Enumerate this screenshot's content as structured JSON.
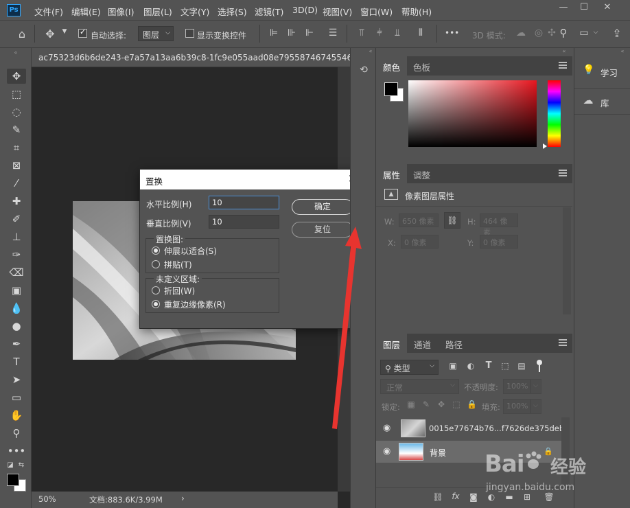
{
  "app": {
    "logo": "Ps"
  },
  "menu": [
    "文件(F)",
    "编辑(E)",
    "图像(I)",
    "图层(L)",
    "文字(Y)",
    "选择(S)",
    "滤镜(T)",
    "3D(D)",
    "视图(V)",
    "窗口(W)",
    "帮助(H)"
  ],
  "window_controls": {
    "minimize": "—",
    "maximize": "☐",
    "close": "✕"
  },
  "options": {
    "auto_select_label": "自动选择:",
    "auto_select_checked": true,
    "auto_select_value": "图层",
    "show_transform_label": "显示变换控件",
    "show_transform_checked": false,
    "mode_3d_label": "3D 模式:",
    "more": "•••"
  },
  "document": {
    "tab_title": "ac75323d6b6de243-e7a57a13aa6b39c8-1fc9e055aad08e79558746745546",
    "zoom": "50%",
    "doc_info": "文档:883.6K/3.99M",
    "status_arrow": "›"
  },
  "dialog": {
    "title": "置换",
    "close": "✕",
    "h_scale_label": "水平比例(H)",
    "h_scale_value": "10",
    "v_scale_label": "垂直比例(V)",
    "v_scale_value": "10",
    "map_group": "置换图:",
    "map_opt1": "伸展以适合(S)",
    "map_opt2": "拼贴(T)",
    "map_selected": 0,
    "undef_group": "未定义区域:",
    "undef_opt1": "折回(W)",
    "undef_opt2": "重复边缘像素(R)",
    "undef_selected": 1,
    "ok": "确定",
    "reset": "复位"
  },
  "color_panel": {
    "tabs": [
      "颜色",
      "色板"
    ],
    "active": 0,
    "fg": "#000000",
    "bg": "#ffffff",
    "hue": "#e8161f"
  },
  "properties_panel": {
    "tabs": [
      "属性",
      "调整"
    ],
    "active": 0,
    "title": "像素图层属性",
    "w_label": "W:",
    "w_value": "650 像素",
    "h_label": "H:",
    "h_value": "464 像素",
    "x_label": "X:",
    "x_value": "0 像素",
    "y_label": "Y:",
    "y_value": "0 像素"
  },
  "layers_panel": {
    "tabs": [
      "图层",
      "通道",
      "路径"
    ],
    "active": 0,
    "filter_kind": "类型",
    "blend_mode": "正常",
    "opacity_label": "不透明度:",
    "opacity": "100%",
    "lock_label": "锁定:",
    "fill_label": "填充:",
    "fill": "100%",
    "layers": [
      {
        "name": "0015e77674b76...f7626de375deb",
        "visible": true,
        "selected": false
      },
      {
        "name": "背景",
        "visible": true,
        "selected": true
      }
    ]
  },
  "side_panels": [
    {
      "label": "学习"
    },
    {
      "label": "库"
    }
  ],
  "watermark": {
    "brand": "Bai",
    "brand_cn": "经验",
    "url": "jingyan.baidu.com"
  }
}
